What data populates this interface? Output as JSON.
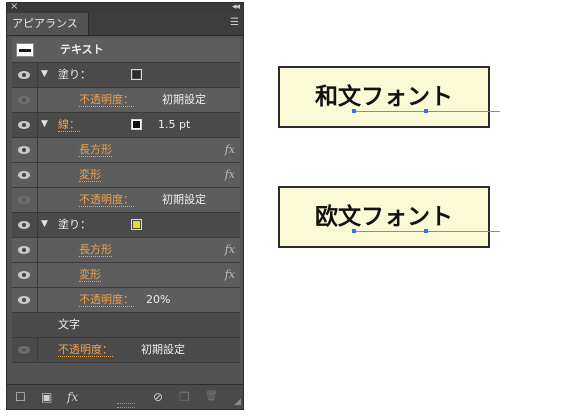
{
  "panel": {
    "tab_title": "アピアランス",
    "close_glyph": "×",
    "collapse_glyph": "◂◂",
    "menu_glyph": "☰",
    "rows": [
      {
        "label": "テキスト"
      },
      {
        "label": "塗り：",
        "swatch": "#2a2a2a"
      },
      {
        "label": "不透明度：",
        "value": "初期設定"
      },
      {
        "label": "線：",
        "swatch": "#111111",
        "value": "1.5 pt"
      },
      {
        "label": "長方形",
        "fx": "fx"
      },
      {
        "label": "変形",
        "fx": "fx"
      },
      {
        "label": "不透明度：",
        "value": "初期設定"
      },
      {
        "label": "塗り：",
        "swatch": "#e3dd1c"
      },
      {
        "label": "長方形",
        "fx": "fx"
      },
      {
        "label": "変形",
        "fx": "fx"
      },
      {
        "label": "不透明度：",
        "value": "20%"
      },
      {
        "label": "文字"
      },
      {
        "label": "不透明度：",
        "value": "初期設定"
      }
    ],
    "bottom_icons": [
      "new-stroke-icon",
      "new-fill-icon",
      "fx-menu-icon",
      "clear-icon",
      "duplicate-icon",
      "delete-icon"
    ],
    "bottom_fx": "fx",
    "bottom_clear": "⊘",
    "bottom_dup": "❐",
    "bottom_del": "🗑",
    "bottom_resize": "◢"
  },
  "samples": [
    {
      "text": "和文フォント"
    },
    {
      "text": "欧文フォント"
    }
  ],
  "colors": {
    "panel_bg": "#535353",
    "link_orange": "#f0a04a",
    "sample_bg": "#fbfad7",
    "fill_yellow": "#e3dd1c"
  }
}
